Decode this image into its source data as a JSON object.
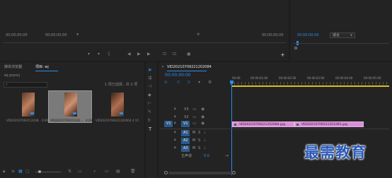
{
  "source_monitor": {
    "left_timecode": "00;00;00;00",
    "center_timecode": "00;00;00;00",
    "right_timecode": "00;00;00;00"
  },
  "program_monitor": {
    "timecode": "00:00:00:00",
    "fit_select": "适合"
  },
  "project": {
    "tabs": [
      "媒体浏览器",
      "项目: wj"
    ],
    "project_file": "wj.prproj",
    "selection_info": "1 项已选择，共 3 项",
    "search_placeholder": "",
    "items": [
      {
        "name": "VID20210709221203B...",
        "duration": "0:00"
      },
      {
        "name": "VID20210709221202...",
        "duration": "4:29"
      },
      {
        "name": "VID20210709221202004",
        "duration": "4:15"
      }
    ]
  },
  "timeline": {
    "sequence_tab": "VID20210709221202084",
    "timecode": "00:00:00:00",
    "ruler": [
      "00:00",
      "00:00:01:00",
      "00:00:02:00",
      "00:00:03:00",
      "00:00:04:00",
      "00:00:05:00"
    ],
    "video_tracks": [
      "V3",
      "V2",
      "V1"
    ],
    "audio_tracks": [
      "A1",
      "A2",
      "A3"
    ],
    "source_v": "V1",
    "source_a": "A1",
    "master_label": "主声道",
    "master_value": "0.0",
    "clips": [
      "VID20210709221202084.jpg",
      "VID20210709221203381.jpg"
    ]
  },
  "watermark": "最需教育",
  "colors": {
    "accent": "#2d8ceb",
    "clip": "#d890d8",
    "panel": "#232323",
    "background": "#1d1d1d",
    "yellow_bar": "#d8c020"
  }
}
